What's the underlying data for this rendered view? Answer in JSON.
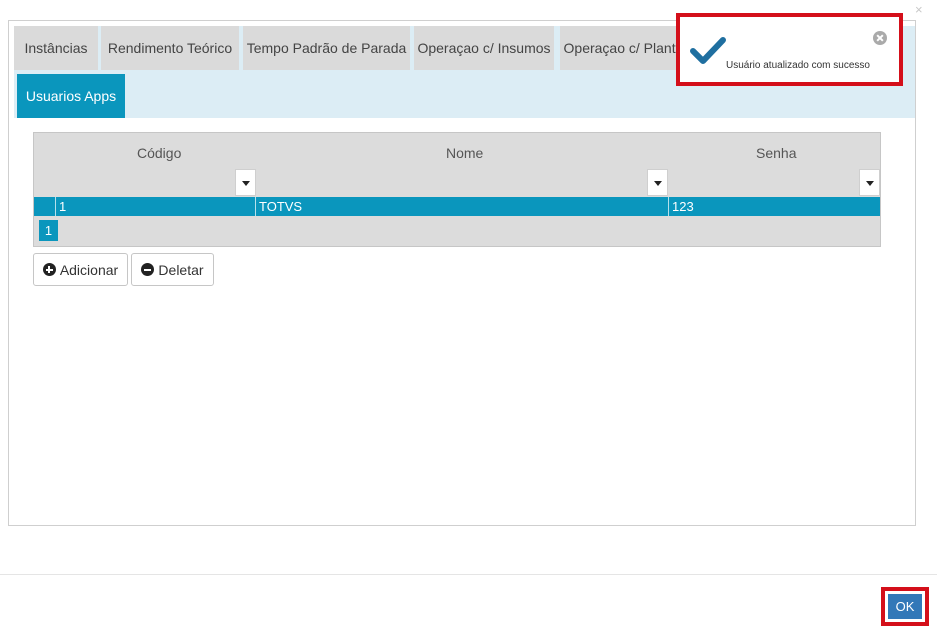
{
  "dialog": {
    "close_icon": "close-icon",
    "close_glyph": "×"
  },
  "tabs": [
    {
      "label": "Instâncias"
    },
    {
      "label": "Rendimento Teórico"
    },
    {
      "label": "Tempo Padrão de Parada"
    },
    {
      "label": "Operaçao c/ Insumos"
    },
    {
      "label": "Operaçao c/ Plantio"
    },
    {
      "label": "Usuarios Apps",
      "active": true
    }
  ],
  "grid": {
    "columns": [
      "Código",
      "Nome",
      "Senha"
    ],
    "rows": [
      {
        "codigo": "1",
        "nome": "TOTVS",
        "senha": "123"
      }
    ],
    "page": "1"
  },
  "actions": {
    "add_label": "Adicionar",
    "add_icon": "plus-circle-icon",
    "delete_label": "Deletar",
    "delete_icon": "minus-circle-icon"
  },
  "toast": {
    "message": "Usuário atualizado com sucesso",
    "icon": "checkmark-icon",
    "close_icon": "close-circle-icon"
  },
  "footer": {
    "ok_label": "OK"
  },
  "colors": {
    "accent": "#0a96bd",
    "tab_bar_bg": "#dcedf5",
    "tab_bg": "#dadada",
    "ok_button": "#3278b8",
    "highlight_border": "#d40f1a"
  }
}
